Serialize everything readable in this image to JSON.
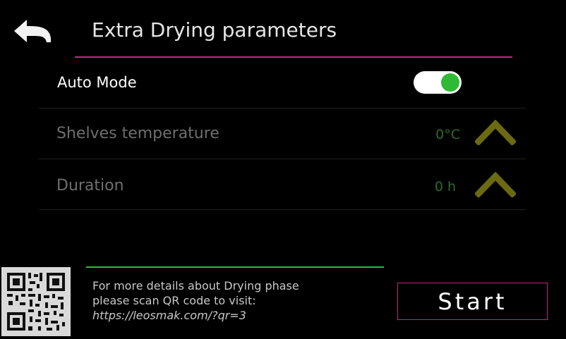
{
  "header": {
    "title": "Extra Drying parameters",
    "back_icon": "back-arrow-icon"
  },
  "auto_mode": {
    "label": "Auto Mode",
    "enabled": true,
    "toggle_on_color": "#2fba35"
  },
  "parameters": [
    {
      "label": "Shelves temperature",
      "value": "0°C",
      "icon": "chevron-up-icon"
    },
    {
      "label": "Duration",
      "value": "0 h",
      "icon": "chevron-up-icon"
    }
  ],
  "info": {
    "line1": "For more details about Drying phase",
    "line2": "please scan QR code to visit:",
    "url": "https://leosmak.com/?qr=3",
    "qr_icon": "qr-code-icon"
  },
  "start_button": {
    "label": "Start"
  },
  "colors": {
    "accent": "#c2297f",
    "green": "#2fba35",
    "arrow": "#6b6a10",
    "value_text": "#2f6b2a",
    "disabled_text": "#6e6e6e"
  }
}
